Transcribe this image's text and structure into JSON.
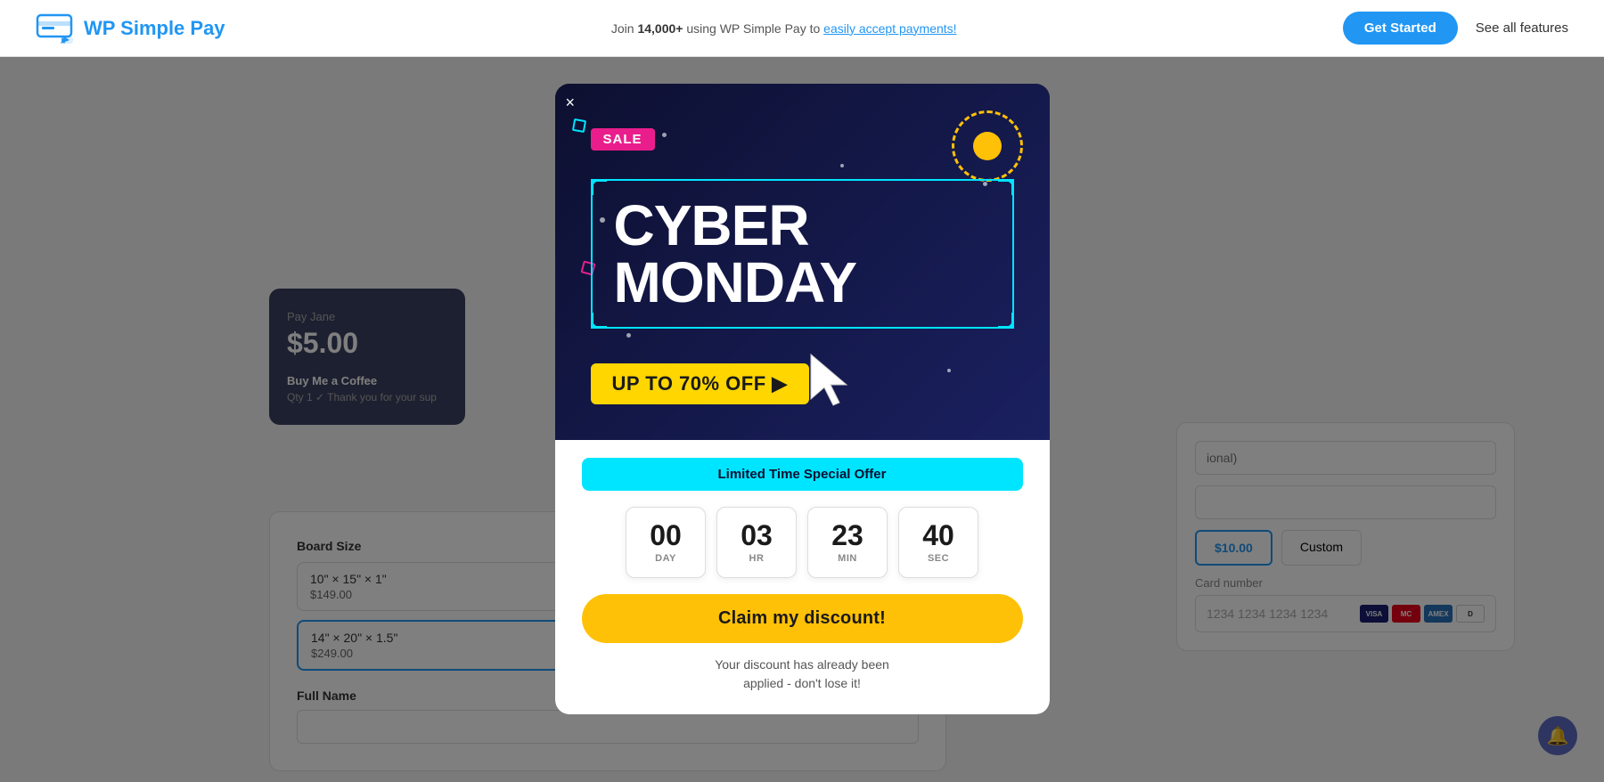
{
  "header": {
    "logo_text": "WP Simple Pay",
    "tagline_prefix": "Join ",
    "tagline_highlight": "14,000+",
    "tagline_suffix": " using WP Simple Pay to ",
    "tagline_link": "easily accept payments!",
    "cta_button": "Get Started",
    "nav_link": "See all features"
  },
  "pay_card": {
    "label": "Pay Jane",
    "amount": "$5.00",
    "desc": "Buy Me a Coffee",
    "qty": "Qty  1 ✓  Thank you for your sup"
  },
  "form": {
    "board_size_label": "Board Size",
    "option1_name": "10\" × 15\" × 1\"",
    "option1_price": "$149.00",
    "option2_name": "14\" × 20\" × 1.5\"",
    "option2_price": "$249.00",
    "full_name_label": "Full Name",
    "full_name_placeholder": ""
  },
  "payment": {
    "optional_placeholder": "ional)",
    "dropdown_placeholder": "",
    "amount_10": "$10.00",
    "amount_custom": "Custom",
    "card_number_label": "Card number",
    "card_number_placeholder": "1234 1234 1234 1234"
  },
  "modal": {
    "close_label": "×",
    "sale_badge": "SALE",
    "cyber_line1": "CYBER",
    "cyber_line2": "MONDAY",
    "discount_text": "UP TO 70% OFF ▶",
    "limited_offer": "Limited Time Special Offer",
    "countdown": [
      {
        "value": "00",
        "label": "DAY"
      },
      {
        "value": "03",
        "label": "HR"
      },
      {
        "value": "23",
        "label": "MIN"
      },
      {
        "value": "40",
        "label": "SEC"
      }
    ],
    "cta_button": "Claim my discount!",
    "discount_applied_line1": "Your discount has already been",
    "discount_applied_line2": "applied - don't lose it!"
  },
  "notification": {
    "icon": "🔔"
  }
}
